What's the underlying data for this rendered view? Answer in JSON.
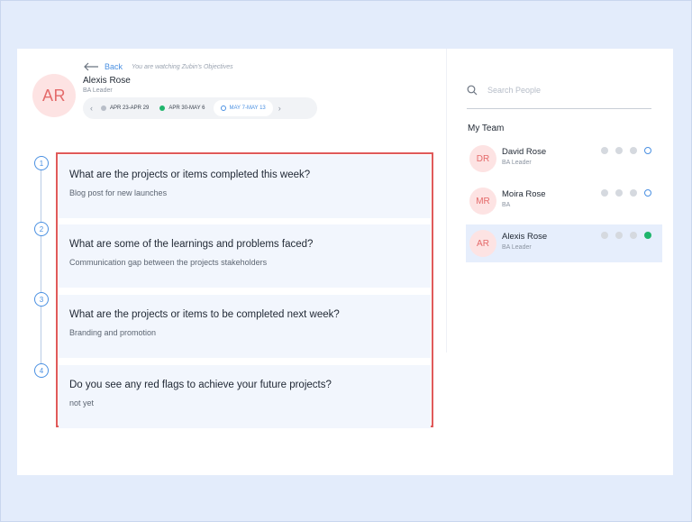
{
  "header": {
    "avatar_initials": "AR",
    "back_label": "Back",
    "watching_text": "You are watching Zubin's Objectives",
    "name": "Alexis Rose",
    "role": "BA Leader",
    "weeks": [
      {
        "label": "APR 23-APR 29",
        "status": "grey"
      },
      {
        "label": "APR 30-MAY 6",
        "status": "green"
      },
      {
        "label": "MAY 7-MAY 13",
        "status": "current"
      }
    ]
  },
  "objectives": [
    {
      "step": "1",
      "question": "What are the projects or items completed this week?",
      "answer": "Blog post for new launches"
    },
    {
      "step": "2",
      "question": "What are some of the learnings and problems faced?",
      "answer": "Communication gap between the projects stakeholders"
    },
    {
      "step": "3",
      "question": "What are the projects or items to be completed next week?",
      "answer": "Branding and promotion"
    },
    {
      "step": "4",
      "question": "Do you see any red flags  to achieve your future projects?",
      "answer": "not yet"
    }
  ],
  "team_panel": {
    "search_placeholder": "Search People",
    "title": "My Team",
    "members": [
      {
        "initials": "DR",
        "name": "David Rose",
        "role": "BA Leader",
        "status": [
          "grey",
          "grey",
          "grey",
          "open"
        ],
        "selected": false
      },
      {
        "initials": "MR",
        "name": "Moira Rose",
        "role": "BA",
        "status": [
          "grey",
          "grey",
          "grey",
          "open"
        ],
        "selected": false
      },
      {
        "initials": "AR",
        "name": "Alexis Rose",
        "role": "BA Leader",
        "status": [
          "grey",
          "grey",
          "grey",
          "green"
        ],
        "selected": true
      }
    ]
  },
  "colors": {
    "accent": "#4a90e2",
    "highlight_border": "#e05a5a",
    "avatar_bg": "#fde3e3",
    "avatar_text": "#e46a6a",
    "success": "#1fb56c"
  }
}
